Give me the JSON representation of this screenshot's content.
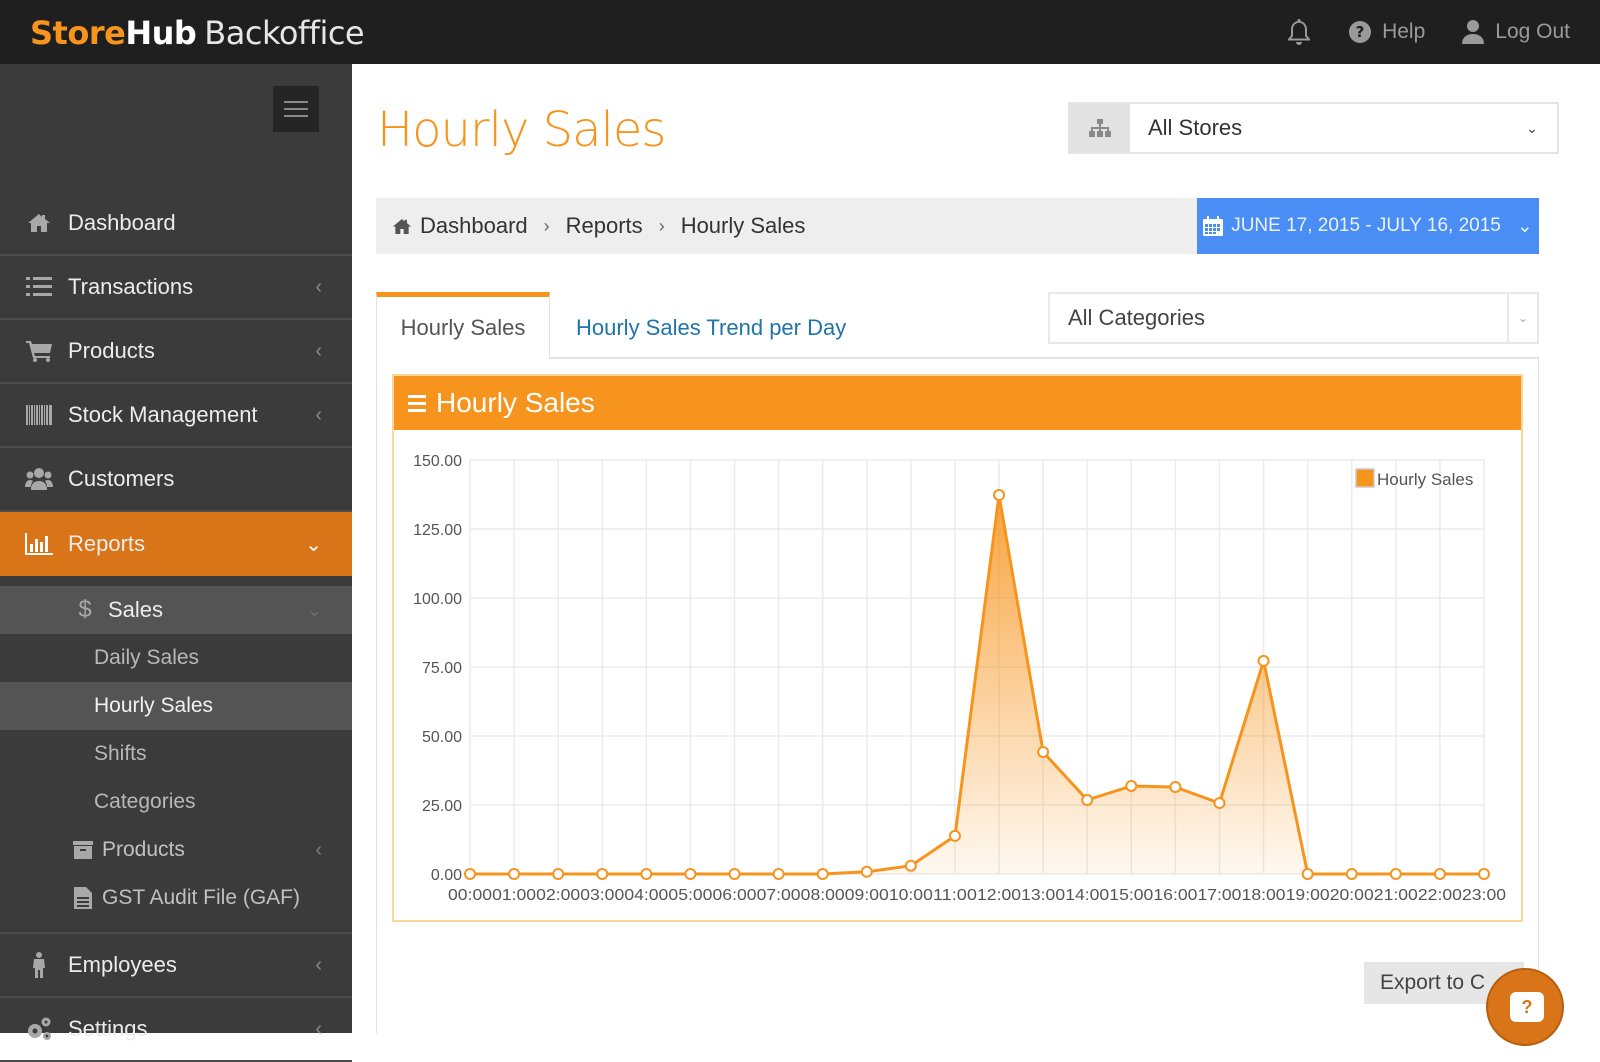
{
  "app": {
    "logo_part1": "Store",
    "logo_part2": "Hub",
    "logo_part3": "Backoffice"
  },
  "topbar": {
    "notifications_icon": "bell-icon",
    "help_label": "Help",
    "logout_label": "Log Out"
  },
  "sidebar": {
    "items": [
      {
        "label": "Dashboard",
        "icon": "home-icon",
        "has_chevron": false
      },
      {
        "label": "Transactions",
        "icon": "ordered-list-icon",
        "has_chevron": true
      },
      {
        "label": "Products",
        "icon": "cart-icon",
        "has_chevron": true
      },
      {
        "label": "Stock Management",
        "icon": "barcode-icon",
        "has_chevron": true
      },
      {
        "label": "Customers",
        "icon": "users-icon",
        "has_chevron": false
      },
      {
        "label": "Reports",
        "icon": "bar-chart-icon",
        "has_chevron": true,
        "active": true
      },
      {
        "label": "Employees",
        "icon": "person-icon",
        "has_chevron": true
      },
      {
        "label": "Settings",
        "icon": "gears-icon",
        "has_chevron": true
      }
    ],
    "reports_sub": {
      "sales_label": "Sales",
      "sales_icon": "dollar-icon",
      "sales_links": [
        "Daily Sales",
        "Hourly Sales",
        "Shifts",
        "Categories"
      ],
      "current": "Hourly Sales",
      "products_label": "Products",
      "gaf_label": "GST Audit File (GAF)"
    }
  },
  "page": {
    "title": "Hourly Sales",
    "store_select": "All Stores",
    "breadcrumb": [
      "Dashboard",
      "Reports",
      "Hourly Sales"
    ],
    "date_range": "JUNE 17, 2015 - JULY 16, 2015",
    "tabs": [
      "Hourly Sales",
      "Hourly Sales Trend per Day"
    ],
    "active_tab": "Hourly Sales",
    "category_select": "All Categories",
    "panel_title": "Hourly Sales",
    "export_label": "Export to C",
    "help_bubble": "?"
  },
  "colors": {
    "accent": "#f7941d",
    "sidebar_active": "#d97418",
    "date_button": "#4a8df5",
    "link": "#1f74a8"
  },
  "chart_data": {
    "type": "area",
    "title": "Hourly Sales",
    "xlabel": "",
    "ylabel": "",
    "categories": [
      "00:00",
      "01:00",
      "02:00",
      "03:00",
      "04:00",
      "05:00",
      "06:00",
      "07:00",
      "08:00",
      "09:00",
      "10:00",
      "11:00",
      "12:00",
      "13:00",
      "14:00",
      "15:00",
      "16:00",
      "17:00",
      "18:00",
      "19:00",
      "20:00",
      "21:00",
      "22:00",
      "23:00"
    ],
    "series": [
      {
        "name": "Hourly Sales",
        "values": [
          0,
          0,
          0,
          0,
          0,
          0,
          0,
          0,
          0,
          0.8,
          3,
          13.8,
          137.3,
          44.2,
          26.8,
          31.9,
          31.5,
          25.7,
          77.2,
          0,
          0,
          0,
          0,
          0
        ]
      }
    ],
    "y_ticks": [
      "0.00",
      "25.00",
      "50.00",
      "75.00",
      "100.00",
      "125.00",
      "150.00"
    ],
    "ylim": [
      0,
      150
    ],
    "grid": true,
    "legend": "top-right",
    "color": "#f7941d"
  }
}
